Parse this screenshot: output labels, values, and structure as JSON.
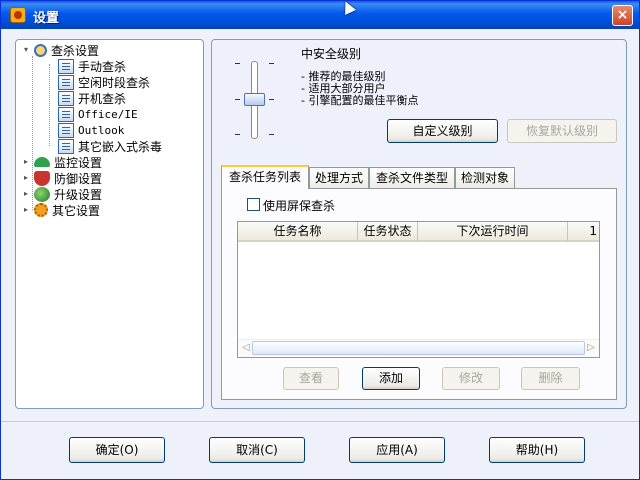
{
  "window": {
    "title": "设置",
    "close_label": "×"
  },
  "tree": {
    "root": {
      "label": "查杀设置",
      "icon": "magnifier-icon"
    },
    "children": [
      {
        "label": "手动查杀",
        "icon": "document-icon"
      },
      {
        "label": "空闲时段查杀",
        "icon": "document-icon",
        "selected": true
      },
      {
        "label": "开机查杀",
        "icon": "document-icon"
      },
      {
        "label": "Office/IE",
        "icon": "document-icon"
      },
      {
        "label": "Outlook",
        "icon": "document-icon"
      },
      {
        "label": "其它嵌入式杀毒",
        "icon": "document-icon"
      }
    ],
    "others": [
      {
        "label": "监控设置",
        "icon": "umbrella-icon"
      },
      {
        "label": "防御设置",
        "icon": "shield-icon"
      },
      {
        "label": "升级设置",
        "icon": "globe-icon"
      },
      {
        "label": "其它设置",
        "icon": "gear-icon"
      }
    ]
  },
  "level": {
    "title": "中安全级别",
    "desc": [
      "- 推荐的最佳级别",
      "- 适用大部分用户",
      "- 引擎配置的最佳平衡点"
    ],
    "custom_button": "自定义级别",
    "restore_button": "恢复默认级别"
  },
  "tabs": [
    "查杀任务列表",
    "处理方式",
    "查杀文件类型",
    "检测对象"
  ],
  "screensaver_checkbox": {
    "label": "使用屏保查杀",
    "checked": false
  },
  "task_table": {
    "columns": [
      "任务名称",
      "任务状态",
      "下次运行时间",
      "1"
    ],
    "rows": []
  },
  "task_buttons": {
    "view": "查看",
    "add": "添加",
    "edit": "修改",
    "delete": "删除"
  },
  "footer": {
    "ok": "确定(O)",
    "cancel": "取消(C)",
    "apply": "应用(A)",
    "help": "帮助(H)"
  }
}
